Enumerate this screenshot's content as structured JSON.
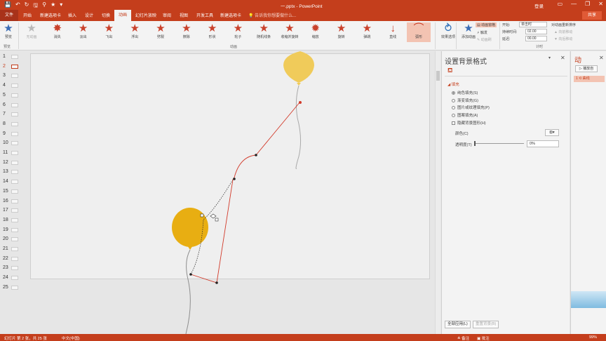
{
  "window": {
    "doc_title": "一.pptx  -  PowerPoint",
    "sign_in": "登录",
    "share": "共享",
    "qat": [
      "💾",
      "↶",
      "↻",
      "🖫",
      "⚲",
      "★",
      "▾"
    ],
    "controls": [
      "▭",
      "—",
      "❐",
      "✕"
    ]
  },
  "tabs": {
    "file": "文件",
    "items": [
      "开始",
      "新建选项卡",
      "插入",
      "设计",
      "切换",
      "动画",
      "幻灯片放映",
      "审阅",
      "视图",
      "开发工具",
      "新建选项卡"
    ],
    "active_index": 5,
    "tell_me": "告诉我你想要做什么..."
  },
  "ribbon": {
    "preview_label": "预览",
    "preview_group": "预览",
    "animation_group": "动画",
    "timing_group": "计时",
    "effects": [
      {
        "label": "无动画",
        "icon": "★",
        "state": "disabled"
      },
      {
        "label": "消失",
        "icon": "✸",
        "state": "normal"
      },
      {
        "label": "淡出",
        "icon": "★",
        "state": "normal"
      },
      {
        "label": "飞出",
        "icon": "★",
        "state": "normal"
      },
      {
        "label": "浮出",
        "icon": "★",
        "state": "normal"
      },
      {
        "label": "劈裂",
        "icon": "★",
        "state": "normal"
      },
      {
        "label": "擦除",
        "icon": "★",
        "state": "normal"
      },
      {
        "label": "形状",
        "icon": "★",
        "state": "normal"
      },
      {
        "label": "轮子",
        "icon": "★",
        "state": "normal"
      },
      {
        "label": "随机线条",
        "icon": "★",
        "state": "normal"
      },
      {
        "label": "收缩并旋转",
        "icon": "★",
        "state": "normal"
      },
      {
        "label": "缩放",
        "icon": "✹",
        "state": "normal"
      },
      {
        "label": "旋转",
        "icon": "★",
        "state": "normal"
      },
      {
        "label": "弹跳",
        "icon": "★",
        "state": "normal"
      },
      {
        "label": "直线",
        "icon": "↓",
        "state": "normal"
      },
      {
        "label": "弧形",
        "icon": "⌒",
        "state": "selected"
      }
    ],
    "effect_options": "效果选项",
    "add_animation": "添加动画",
    "animation_pane": "动画窗格",
    "trigger": "触发",
    "animation_painter": "动画刷",
    "start_label": "开始:",
    "start_value": "单击时",
    "duration_label": "持续时间:",
    "duration_value": "02.00",
    "delay_label": "延迟:",
    "delay_value": "00.00",
    "reorder_title": "对动画重新排序",
    "move_earlier": "向前移动",
    "move_later": "向后移动"
  },
  "slides": {
    "numbers": [
      "1",
      "2",
      "3",
      "4",
      "5",
      "6",
      "7",
      "8",
      "9",
      "10",
      "11",
      "12",
      "13",
      "14",
      "15",
      "16",
      "17",
      "18",
      "19",
      "20",
      "21",
      "22",
      "23",
      "24",
      "25"
    ],
    "active": "2"
  },
  "format_pane": {
    "title": "设置背景格式",
    "section": "填充",
    "options": [
      "纯色填充(S)",
      "渐变填充(G)",
      "图片或纹理填充(P)",
      "图案填充(A)"
    ],
    "selected_option": 0,
    "hide_bg": "隐藏背景图形(H)",
    "color_label": "颜色(C)",
    "transparency_label": "透明度(T)",
    "transparency_value": "0%",
    "apply_all": "全部应用(L)",
    "reset_bg": "重置背景(B)",
    "dropdown": "▾",
    "close": "✕"
  },
  "animation_pane": {
    "title": "动",
    "play": "▷ 播放自",
    "item": "1 ⟲ 曲线"
  },
  "status": {
    "slide_info": "幻灯片 第 2 张，共 25 张",
    "language": "中文(中国)",
    "notes": "≙ 备注",
    "comments": "▣ 批注",
    "zoom": "99%"
  },
  "colors": {
    "accent": "#c43e1c",
    "balloon_light": "#f0cb5a",
    "balloon_dark": "#e8ae12",
    "path_red": "#d23a2a"
  }
}
